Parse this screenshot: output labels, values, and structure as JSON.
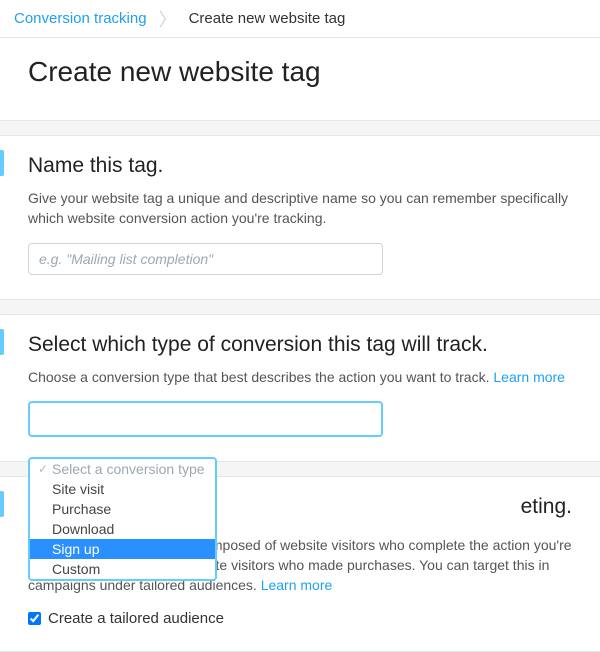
{
  "breadcrumb": {
    "root": "Conversion tracking",
    "current": "Create new website tag"
  },
  "header": {
    "title": "Create new website tag"
  },
  "name_section": {
    "title": "Name this tag.",
    "desc": "Give your website tag a unique and descriptive name so you can remember specifically which website conversion action you're tracking.",
    "placeholder": "e.g. \"Mailing list completion\""
  },
  "type_section": {
    "title": "Select which type of conversion this tag will track.",
    "desc": "Choose a conversion type that best describes the action you want to track. ",
    "learn": "Learn more",
    "options": {
      "placeholder": "Select a conversion type",
      "o1": "Site visit",
      "o2": "Purchase",
      "o3": "Download",
      "o4": "Sign up",
      "o5": "Custom"
    }
  },
  "audience_section": {
    "title_suffix": "eting.",
    "desc": "Create a tailored audience composed of website visitors who complete the action you're tracking — for example, website visitors who made purchases. You can target this in campaigns under tailored audiences. ",
    "learn": "Learn more",
    "checkbox_label": "Create a tailored audience"
  }
}
